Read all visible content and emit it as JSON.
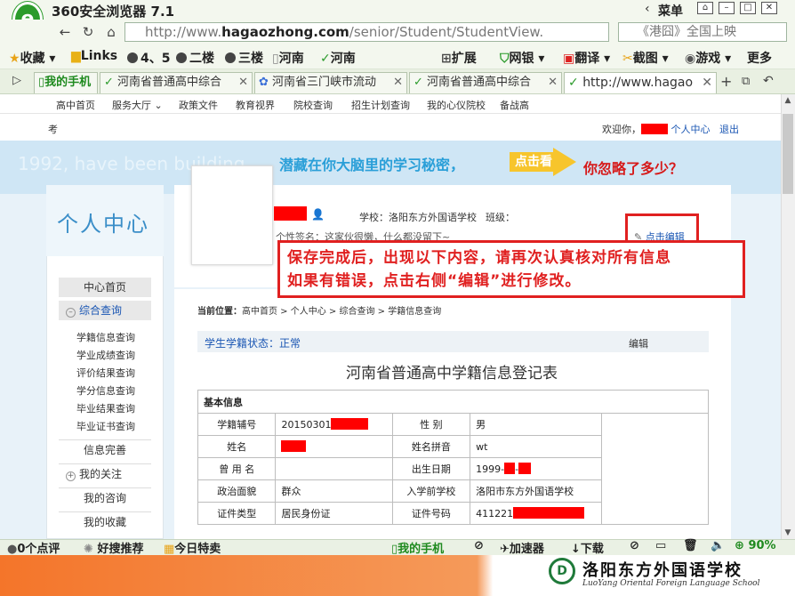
{
  "browser": {
    "title": "360安全浏览器 7.1",
    "menu": "菜单",
    "url_prefix": "http://www.",
    "url_domain": "hagaozhong.com",
    "url_path": "/senior/Student/StudentView.",
    "search_text": "《港囧》全国上映",
    "bookmarks": [
      "收藏",
      "Links",
      "4、5",
      "二楼",
      "三楼",
      "河南",
      "河南"
    ],
    "tools": [
      "扩展",
      "网银",
      "翻译",
      "截图",
      "游戏",
      "更多"
    ],
    "tabs": [
      "我的手机",
      "河南省普通高中综合",
      "河南省三门峡市流动",
      "河南省普通高中综合",
      "http://www.hagao"
    ]
  },
  "site_nav": [
    "高中首页",
    "服务大厅",
    "政策文件",
    "教育视界",
    "院校查询",
    "招生计划查询",
    "我的心仪院校",
    "备战高"
  ],
  "userbar": {
    "kao": "考",
    "welcome": "欢迎你，",
    "center": "个人中心",
    "logout": "退出"
  },
  "banner": {
    "ghost": "1992, have been building...",
    "main": "潜藏在你大脑里的学习秘密，",
    "button": "点击看",
    "red": "你忽略了多少？"
  },
  "sidebar": {
    "title": "个人中心",
    "home": "中心首页",
    "query": "综合查询",
    "subitems": [
      "学籍信息查询",
      "学业成绩查询",
      "评价结果查询",
      "学分信息查询",
      "毕业结果查询",
      "毕业证书查询"
    ],
    "info": "信息完善",
    "follow": "我的关注",
    "consult": "我的咨询",
    "collect": "我的收藏"
  },
  "profile": {
    "school": "学校：洛阳东方外国语学校",
    "class": "班级：",
    "signature": "个性签名：这家伙很懒，什么都没留下~",
    "edit": "点击编辑"
  },
  "notice": {
    "line1": "保存完成后，出现以下内容，请再次认真核对所有信息",
    "line2": "如果有错误，点击右侧“编辑”进行修改。"
  },
  "content": {
    "crumb_label": "当前位置：",
    "crumb": "高中首页 > 个人中心 > 综合查询 > 学籍信息查询",
    "status": "学生学籍状态：正常",
    "edit": "编辑",
    "form_title": "河南省普通高中学籍信息登记表",
    "section": "基本信息",
    "rows": [
      {
        "l1": "学籍辅号",
        "v1": "20150301",
        "l2": "性 别",
        "v2": "男"
      },
      {
        "l1": "姓名",
        "v1": "",
        "l2": "姓名拼音",
        "v2": "wt"
      },
      {
        "l1": "曾 用 名",
        "v1": "",
        "l2": "出生日期",
        "v2": "1999-"
      },
      {
        "l1": "政治面貌",
        "v1": "群众",
        "l2": "入学前学校",
        "v2": "洛阳市东方外国语学校"
      },
      {
        "l1": "证件类型",
        "v1": "居民身份证",
        "l2": "证件号码",
        "v2": "411221"
      }
    ]
  },
  "statusbar": {
    "comments": "0个点评",
    "recommend": "好搜推荐",
    "special": "今日特卖",
    "phone": "我的手机",
    "accel": "加速器",
    "download": "下载",
    "zoom": "90%"
  },
  "footer": {
    "school_cn": "洛阳东方外国语学校",
    "school_en": "LuoYang Oriental Foreign Language School"
  }
}
